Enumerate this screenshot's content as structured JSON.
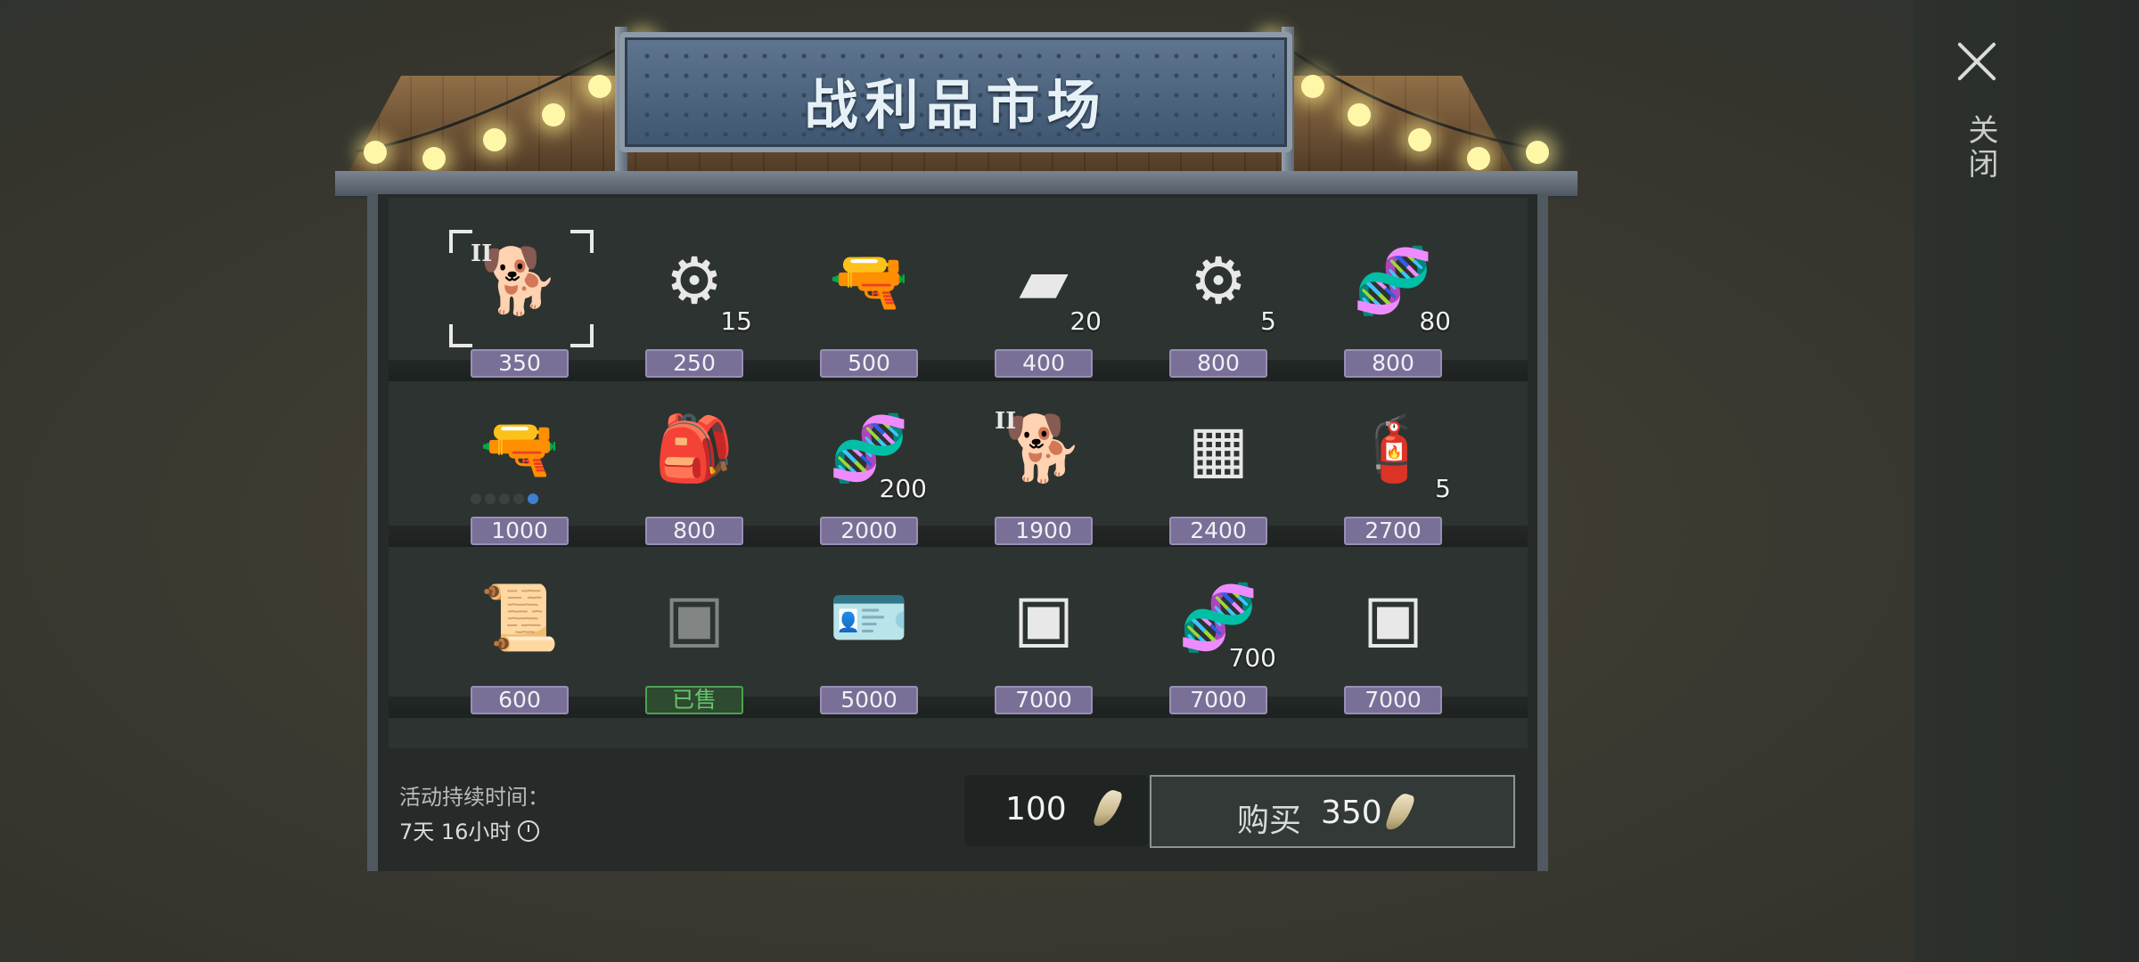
{
  "header": {
    "title": "战利品市场"
  },
  "close": {
    "label": "关闭",
    "icon": "close-icon"
  },
  "currency_icon": "tooth-icon",
  "colors": {
    "price_tag": "#7a6f97",
    "sold": "#4aa452",
    "sign": "#4d6580"
  },
  "items": [
    {
      "id": "dog-puppy-dark",
      "icon": "dog-icon",
      "price": "350",
      "qty": "",
      "tier": "II",
      "selected": true
    },
    {
      "id": "engine-part",
      "icon": "engine-icon",
      "price": "250",
      "qty": "15",
      "tier": ""
    },
    {
      "id": "assault-rifle",
      "icon": "rifle-icon",
      "price": "500",
      "qty": "",
      "tier": ""
    },
    {
      "id": "black-cloth",
      "icon": "cloth-icon",
      "price": "400",
      "qty": "20",
      "tier": ""
    },
    {
      "id": "gear",
      "icon": "gear-icon",
      "price": "800",
      "qty": "5",
      "tier": ""
    },
    {
      "id": "dna-capsule",
      "icon": "dna-capsule-icon",
      "price": "800",
      "qty": "80",
      "tier": ""
    },
    {
      "id": "sniper-rifle",
      "icon": "sniper-rifle-icon",
      "price": "1000",
      "qty": "",
      "tier": "",
      "dots": 5,
      "active_dot": 5
    },
    {
      "id": "backpack",
      "icon": "backpack-icon",
      "price": "800",
      "qty": "",
      "tier": ""
    },
    {
      "id": "dna-capsule-2",
      "icon": "dna-capsule-icon",
      "price": "2000",
      "qty": "200",
      "tier": ""
    },
    {
      "id": "dog-puppy-brown",
      "icon": "dog-icon",
      "price": "1900",
      "qty": "",
      "tier": "II"
    },
    {
      "id": "circuit-board",
      "icon": "chip-icon",
      "price": "2400",
      "qty": "",
      "tier": ""
    },
    {
      "id": "gas-canister",
      "icon": "gas-canister-icon",
      "price": "2700",
      "qty": "5",
      "tier": ""
    },
    {
      "id": "scroll-case",
      "icon": "scroll-icon",
      "price": "600",
      "qty": "",
      "tier": ""
    },
    {
      "id": "crate-sold",
      "icon": "crate-icon",
      "price": "已售",
      "qty": "",
      "tier": "",
      "sold": true
    },
    {
      "id": "badge-wallet",
      "icon": "badge-icon",
      "price": "5000",
      "qty": "",
      "tier": ""
    },
    {
      "id": "crate-1",
      "icon": "crate-icon",
      "price": "7000",
      "qty": "",
      "tier": ""
    },
    {
      "id": "dna-capsule-3",
      "icon": "dna-capsule-icon",
      "price": "7000",
      "qty": "700",
      "tier": ""
    },
    {
      "id": "crate-2",
      "icon": "crate-icon",
      "price": "7000",
      "qty": "",
      "tier": ""
    }
  ],
  "timer": {
    "label": "活动持续时间：",
    "value": "7天 16小时"
  },
  "balance": {
    "value": "100"
  },
  "buy": {
    "label": "购买",
    "amount": "350"
  }
}
